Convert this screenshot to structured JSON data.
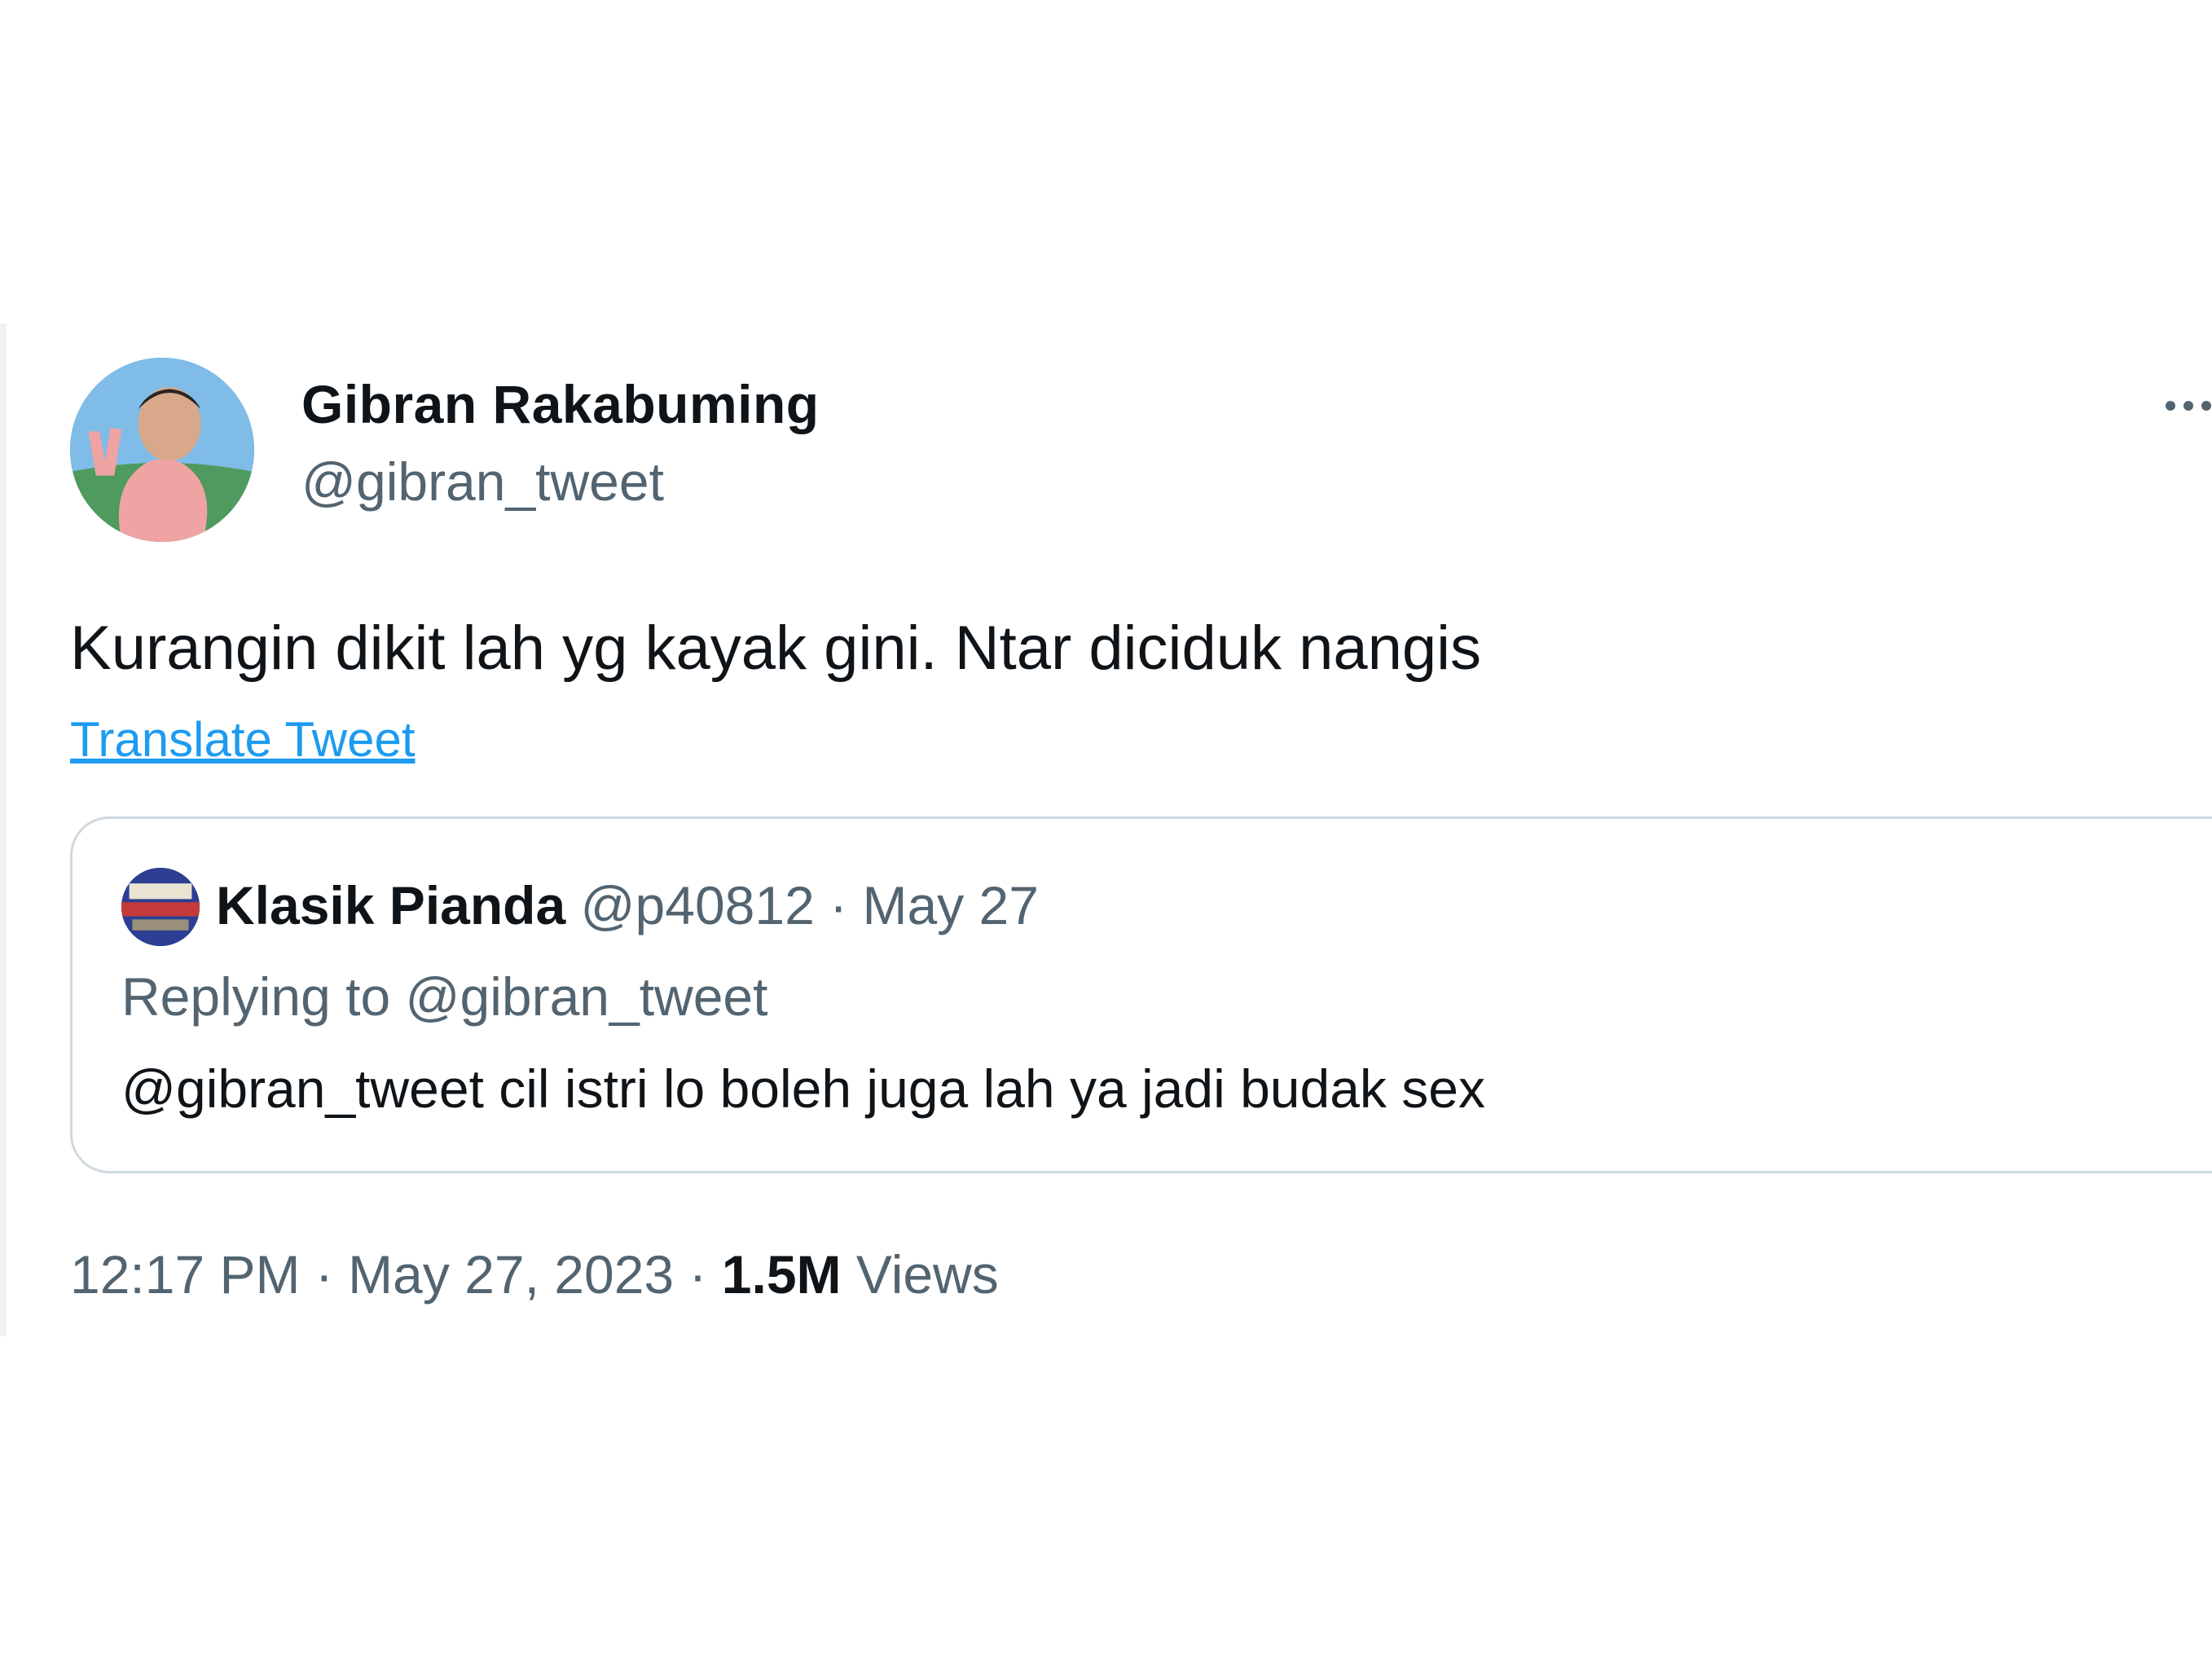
{
  "tweet": {
    "author": {
      "display_name": "Gibran Rakabuming",
      "handle": "@gibran_tweet"
    },
    "text": "Kurangin dikit lah yg kayak gini. Ntar diciduk nangis",
    "translate_label": "Translate Tweet",
    "quoted": {
      "display_name": "Klasik Pianda",
      "handle": "@p40812",
      "separator": "·",
      "date": "May 27",
      "replying_to": "Replying to @gibran_tweet",
      "text": "@gibran_tweet cil istri lo boleh juga lah ya jadi budak sex"
    },
    "time": "12:17 PM",
    "full_date": "May 27, 2023",
    "separator": "·",
    "views_count": "1.5M",
    "views_label": "Views"
  },
  "icons": {
    "more": "more-horizontal-icon"
  },
  "colors": {
    "text_primary": "#0f1419",
    "text_secondary": "#536471",
    "link": "#1d9bf0",
    "border": "#cfd9de"
  }
}
